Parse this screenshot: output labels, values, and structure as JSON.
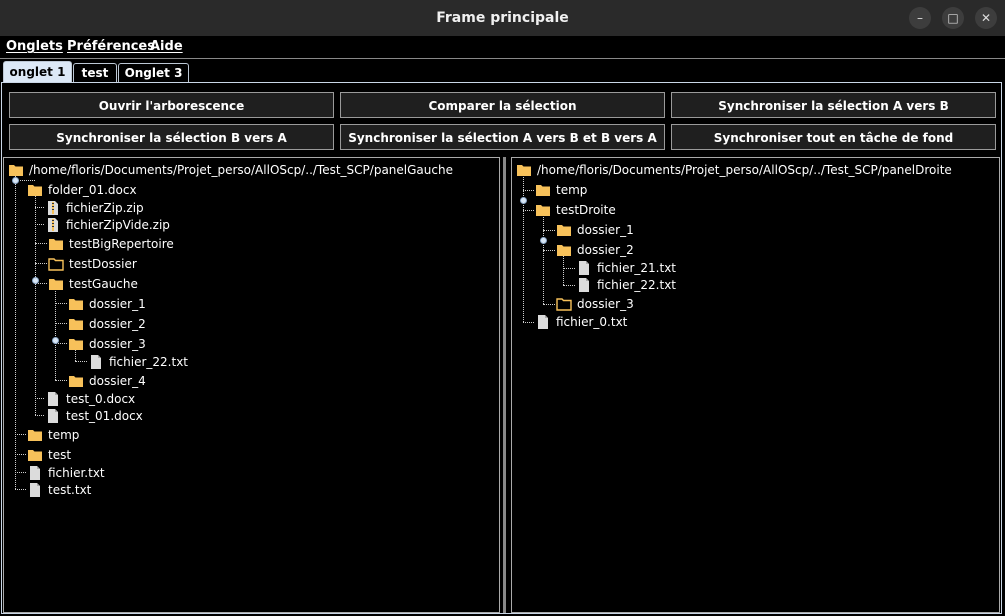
{
  "window": {
    "title": "Frame principale"
  },
  "menu": [
    "Onglets",
    "Préférences",
    "Aide"
  ],
  "tabs": [
    "onglet 1",
    "test",
    "Onglet 3"
  ],
  "buttons": [
    "Ouvrir l'arborescence",
    "Comparer la sélection",
    "Synchroniser la sélection A vers B",
    "Synchroniser la sélection B vers A",
    "Synchroniser la sélection A vers B et B vers A",
    "Synchroniser tout en tâche de fond"
  ],
  "left_tree": [
    {
      "label": "/home/floris/Documents/Projet_perso/AllOScp/../Test_SCP/panelGauche",
      "icon": "folder"
    },
    {
      "label": "folder_01.docx",
      "icon": "folder"
    },
    {
      "label": "fichierZip.zip",
      "icon": "zip"
    },
    {
      "label": "fichierZipVide.zip",
      "icon": "zip"
    },
    {
      "label": "testBigRepertoire",
      "icon": "folder"
    },
    {
      "label": "testDossier",
      "icon": "folder-open"
    },
    {
      "label": "testGauche",
      "icon": "folder"
    },
    {
      "label": "dossier_1",
      "icon": "folder"
    },
    {
      "label": "dossier_2",
      "icon": "folder"
    },
    {
      "label": "dossier_3",
      "icon": "folder"
    },
    {
      "label": "fichier_22.txt",
      "icon": "file"
    },
    {
      "label": "dossier_4",
      "icon": "folder"
    },
    {
      "label": "test_0.docx",
      "icon": "file"
    },
    {
      "label": "test_01.docx",
      "icon": "file"
    },
    {
      "label": "temp",
      "icon": "folder"
    },
    {
      "label": "test",
      "icon": "folder"
    },
    {
      "label": "fichier.txt",
      "icon": "file"
    },
    {
      "label": "test.txt",
      "icon": "file"
    }
  ],
  "right_tree": [
    {
      "label": "/home/floris/Documents/Projet_perso/AllOScp/../Test_SCP/panelDroite",
      "icon": "folder"
    },
    {
      "label": "temp",
      "icon": "folder"
    },
    {
      "label": "testDroite",
      "icon": "folder"
    },
    {
      "label": "dossier_1",
      "icon": "folder"
    },
    {
      "label": "dossier_2",
      "icon": "folder"
    },
    {
      "label": "fichier_21.txt",
      "icon": "file"
    },
    {
      "label": "fichier_22.txt",
      "icon": "file"
    },
    {
      "label": "dossier_3",
      "icon": "folder-open"
    },
    {
      "label": "fichier_0.txt",
      "icon": "file"
    }
  ],
  "colors": {
    "folder": "#f7c15a",
    "file": "#dcdcdc",
    "tab_active": "#dce8f6"
  }
}
